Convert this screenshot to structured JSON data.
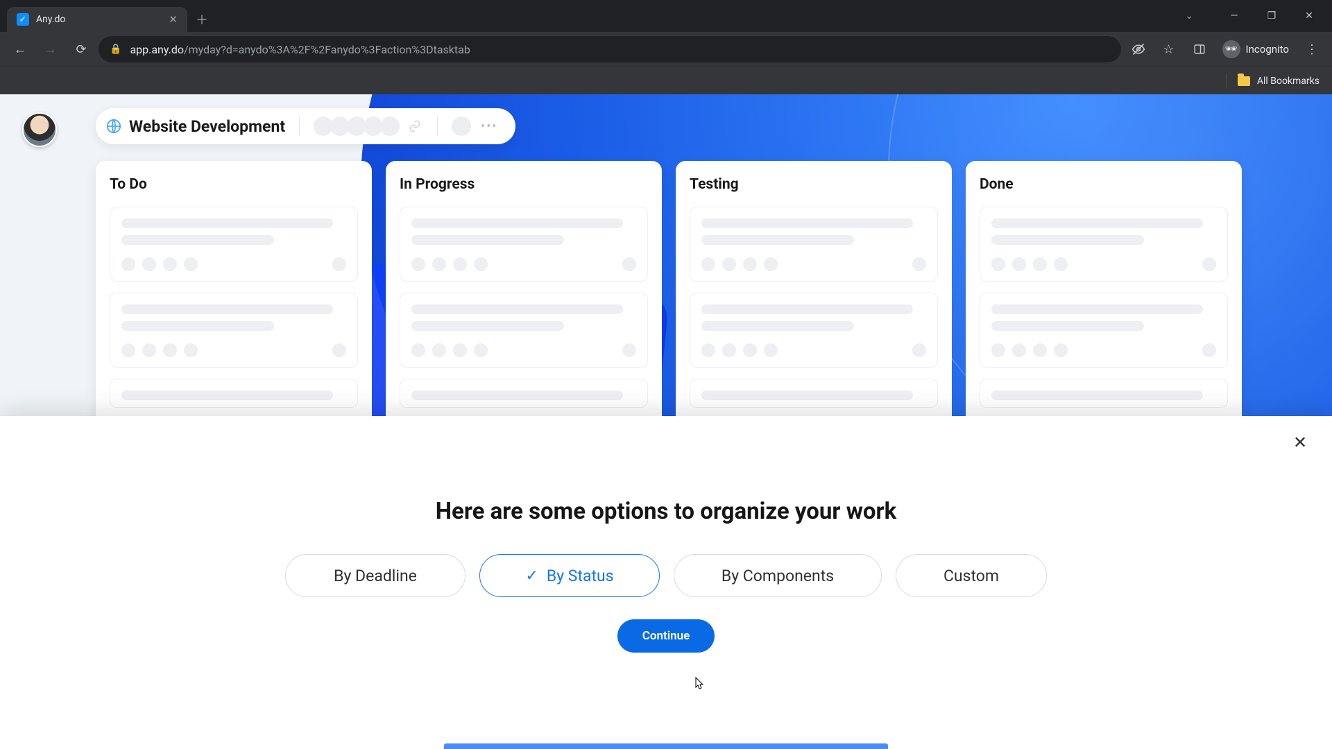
{
  "browser": {
    "tab_title": "Any.do",
    "url_domain": "app.any.do",
    "url_path": "/myday?d=anydo%3A%2F%2Fanydo%3Faction%3Dtasktab",
    "incognito_label": "Incognito",
    "bookmarks_label": "All Bookmarks"
  },
  "board": {
    "title": "Website Development",
    "columns": [
      {
        "title": "To Do"
      },
      {
        "title": "In Progress"
      },
      {
        "title": "Testing"
      },
      {
        "title": "Done"
      }
    ]
  },
  "modal": {
    "title": "Here are some options to organize your work",
    "options": {
      "deadline": "By Deadline",
      "status": "By Status",
      "components": "By Components",
      "custom": "Custom"
    },
    "selected": "status",
    "continue": "Continue"
  }
}
